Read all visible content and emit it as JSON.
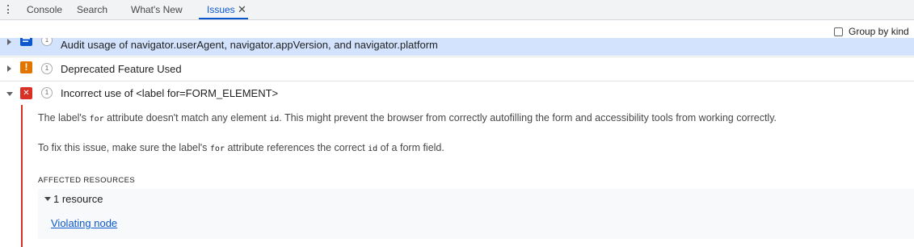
{
  "tabs": [
    {
      "label": "Console"
    },
    {
      "label": "Search"
    },
    {
      "label": "What's New"
    },
    {
      "label": "Issues",
      "close": "✕",
      "active": true
    }
  ],
  "toolbar": {
    "group_by_kind": "Group by kind",
    "group_by_kind_checked": false
  },
  "issues": [
    {
      "icon": "info-icon",
      "color": "#0b57d0",
      "count": "1",
      "title": "Audit usage of navigator.userAgent, navigator.appVersion, and navigator.platform",
      "expanded": false
    },
    {
      "icon": "warning-icon",
      "color": "#e37400",
      "count": "1",
      "title": "Deprecated Feature Used",
      "expanded": false
    },
    {
      "icon": "error-icon",
      "color": "#d93025",
      "count": "1",
      "title": "Incorrect use of <label for=FORM_ELEMENT>",
      "expanded": true
    }
  ],
  "details": {
    "p1": {
      "t1": "The label's ",
      "c1": "for",
      "t2": " attribute doesn't match any element ",
      "c2": "id",
      "t3": ". This might prevent the browser from correctly autofilling the form and accessibility tools from working correctly."
    },
    "p2": {
      "t1": "To fix this issue, make sure the label's ",
      "c1": "for",
      "t2": " attribute references the correct ",
      "c2": "id",
      "t3": " of a form field."
    },
    "affected_heading": "AFFECTED RESOURCES",
    "resource_count": "1 resource",
    "link": "Violating node"
  }
}
